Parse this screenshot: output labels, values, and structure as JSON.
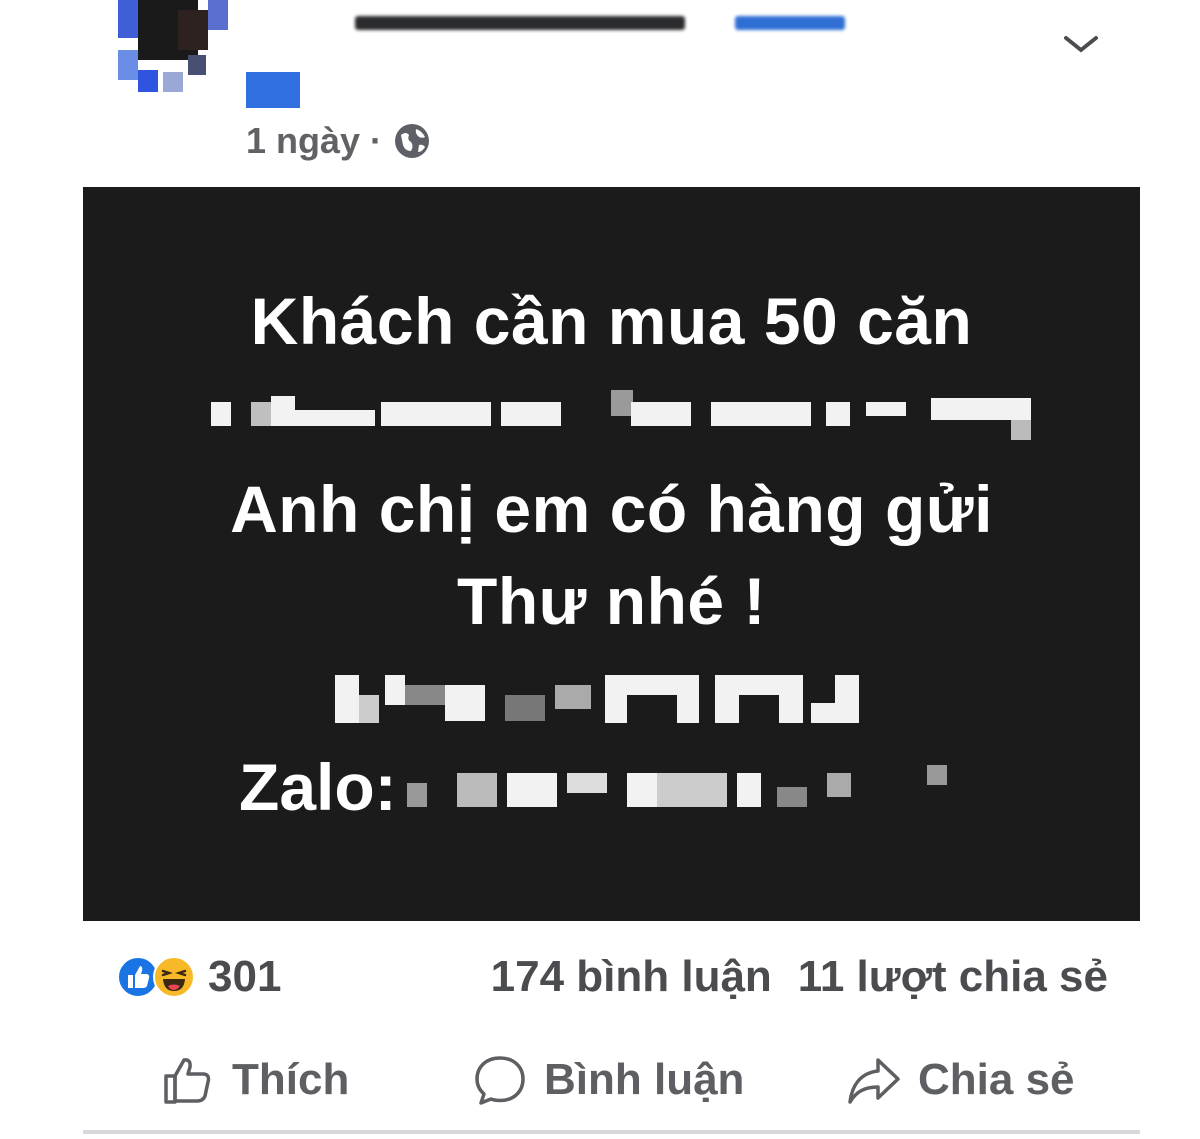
{
  "post": {
    "timestamp": "1 ngày",
    "separator": "·",
    "privacy_icon": "globe-icon",
    "close_icon": "close-icon"
  },
  "image": {
    "line1": "Khách cần mua 50 căn",
    "line3": "Anh chị em có hàng gửi",
    "line4": "Thư nhé !",
    "zalo_label": "Zalo:"
  },
  "stats": {
    "reaction_count": "301",
    "comments": "174 bình luận",
    "shares": "11 lượt chia sẻ"
  },
  "actions": {
    "like": "Thích",
    "comment": "Bình luận",
    "share": "Chia sẻ"
  },
  "colors": {
    "like_blue": "#1b74e4",
    "haha_yellow": "#f7b928",
    "image_bg": "#1b1b1c"
  }
}
